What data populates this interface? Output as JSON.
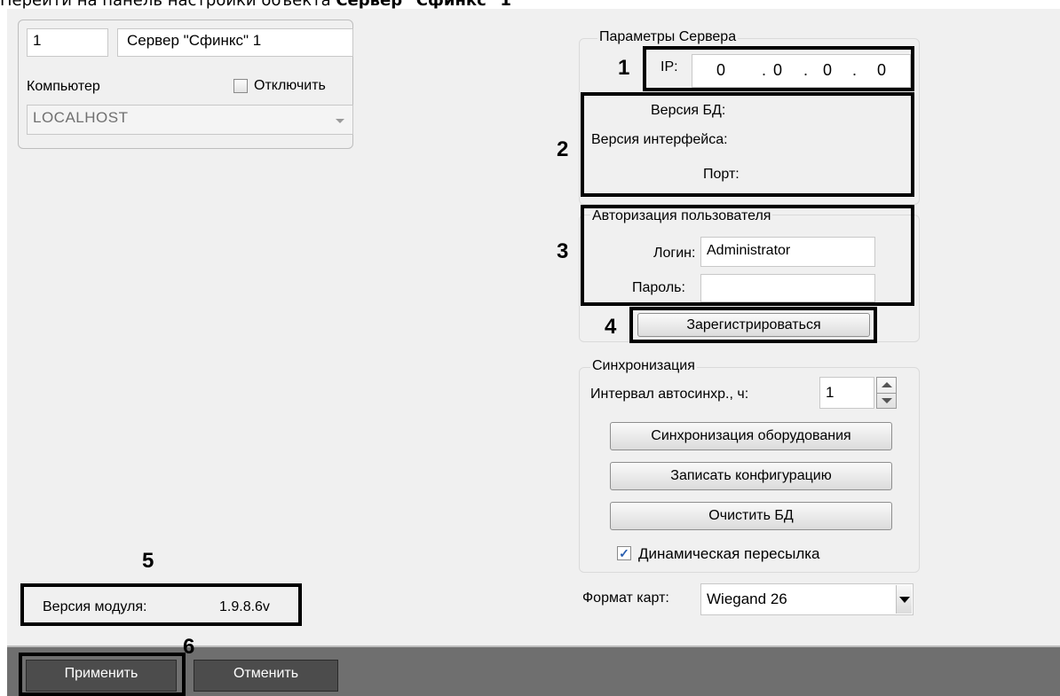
{
  "caption": {
    "prefix": "Перейти на панель настройки объекта ",
    "bold": "Сервер \"Сфинкс\" 1"
  },
  "object": {
    "id": "1",
    "name": "Сервер \"Сфинкс\" 1",
    "computer_label": "Компьютер",
    "disable_label": "Отключить",
    "computer_value": "LOCALHOST"
  },
  "server_params": {
    "title": "Параметры Сервера",
    "ip_label": "IP:",
    "ip_octets": [
      "0",
      "0",
      "0",
      "0"
    ],
    "db_version_label": "Версия БД:",
    "interface_version_label": "Версия интерфейса:",
    "port_label": "Порт:"
  },
  "auth": {
    "title": "Авторизация пользователя",
    "login_label": "Логин:",
    "login_value": "Administrator",
    "password_label": "Пароль:",
    "password_value": "",
    "register_button": "Зарегистрироваться"
  },
  "sync": {
    "title": "Синхронизация",
    "interval_label": "Интервал автосинхр., ч:",
    "interval_value": "1",
    "sync_hw_button": "Синхронизация оборудования",
    "write_config_button": "Записать конфигурацию",
    "clear_db_button": "Очистить БД",
    "dynamic_label": "Динамическая пересылка",
    "dynamic_checked": true
  },
  "card_format": {
    "label": "Формат карт:",
    "value": "Wiegand 26"
  },
  "module": {
    "version_label": "Версия модуля:",
    "version_value": "1.9.8.6v"
  },
  "footer": {
    "apply_button": "Применить",
    "cancel_button": "Отменить"
  },
  "markers": [
    "1",
    "2",
    "3",
    "4",
    "5",
    "6"
  ]
}
